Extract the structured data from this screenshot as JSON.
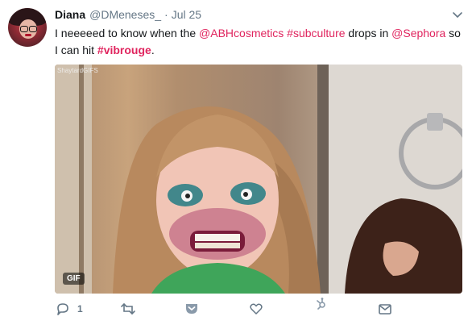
{
  "tweet": {
    "author_name": "Diana",
    "author_handle": "@DMeneses_",
    "separator": "·",
    "date": "Jul 25",
    "text_segments": [
      {
        "text": "I neeeeed to know when the ",
        "style": "plain"
      },
      {
        "text": "@ABHcosmetics",
        "style": "link"
      },
      {
        "text": " ",
        "style": "plain"
      },
      {
        "text": "#subculture",
        "style": "link"
      },
      {
        "text": " drops in ",
        "style": "plain"
      },
      {
        "text": "@Sephora",
        "style": "link"
      },
      {
        "text": " so I can hit ",
        "style": "plain"
      },
      {
        "text": "#vibrouge",
        "style": "link-bold"
      },
      {
        "text": ".",
        "style": "plain"
      }
    ]
  },
  "media": {
    "watermark": "ShaytardGIFS",
    "badge": "GIF"
  },
  "actions": {
    "reply_count": "1",
    "retweet_count": "",
    "like_count": ""
  },
  "colors": {
    "link": "#e0245e",
    "muted": "#657786",
    "text": "#14171a"
  },
  "icons": [
    "avatar",
    "chevron-down-icon",
    "reply-icon",
    "retweet-icon",
    "pocket-icon",
    "like-icon",
    "hubspot-icon",
    "direct-message-icon"
  ]
}
